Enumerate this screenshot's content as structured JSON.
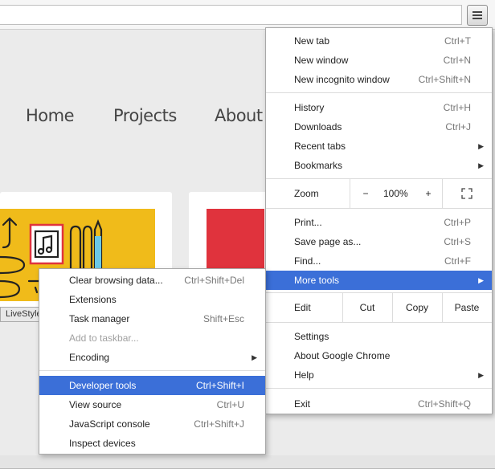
{
  "browser": {
    "menu_button_icon": "hamburger-menu-icon"
  },
  "page": {
    "nav": [
      "Home",
      "Projects",
      "About"
    ],
    "tooltip": "LiveStyle"
  },
  "menu": {
    "new_tab": {
      "label": "New tab",
      "shortcut": "Ctrl+T"
    },
    "new_window": {
      "label": "New window",
      "shortcut": "Ctrl+N"
    },
    "new_incognito": {
      "label": "New incognito window",
      "shortcut": "Ctrl+Shift+N"
    },
    "history": {
      "label": "History",
      "shortcut": "Ctrl+H"
    },
    "downloads": {
      "label": "Downloads",
      "shortcut": "Ctrl+J"
    },
    "recent_tabs": {
      "label": "Recent tabs"
    },
    "bookmarks": {
      "label": "Bookmarks"
    },
    "zoom": {
      "label": "Zoom",
      "minus": "−",
      "value": "100%",
      "plus": "+",
      "fullscreen_icon": "fullscreen-icon"
    },
    "print": {
      "label": "Print...",
      "shortcut": "Ctrl+P"
    },
    "save_page": {
      "label": "Save page as...",
      "shortcut": "Ctrl+S"
    },
    "find": {
      "label": "Find...",
      "shortcut": "Ctrl+F"
    },
    "more_tools": {
      "label": "More tools"
    },
    "edit": {
      "label": "Edit",
      "cut": "Cut",
      "copy": "Copy",
      "paste": "Paste"
    },
    "settings": {
      "label": "Settings"
    },
    "about": {
      "label": "About Google Chrome"
    },
    "help": {
      "label": "Help"
    },
    "exit": {
      "label": "Exit",
      "shortcut": "Ctrl+Shift+Q"
    }
  },
  "submenu": {
    "clear_browsing": {
      "label": "Clear browsing data...",
      "shortcut": "Ctrl+Shift+Del"
    },
    "extensions": {
      "label": "Extensions"
    },
    "task_manager": {
      "label": "Task manager",
      "shortcut": "Shift+Esc"
    },
    "add_taskbar": {
      "label": "Add to taskbar..."
    },
    "encoding": {
      "label": "Encoding"
    },
    "developer_tools": {
      "label": "Developer tools",
      "shortcut": "Ctrl+Shift+I"
    },
    "view_source": {
      "label": "View source",
      "shortcut": "Ctrl+U"
    },
    "js_console": {
      "label": "JavaScript console",
      "shortcut": "Ctrl+Shift+J"
    },
    "inspect_devices": {
      "label": "Inspect devices"
    }
  },
  "colors": {
    "highlight": "#3b6fd8",
    "yellow_card": "#f0bb1a",
    "red_card": "#e0333d"
  }
}
